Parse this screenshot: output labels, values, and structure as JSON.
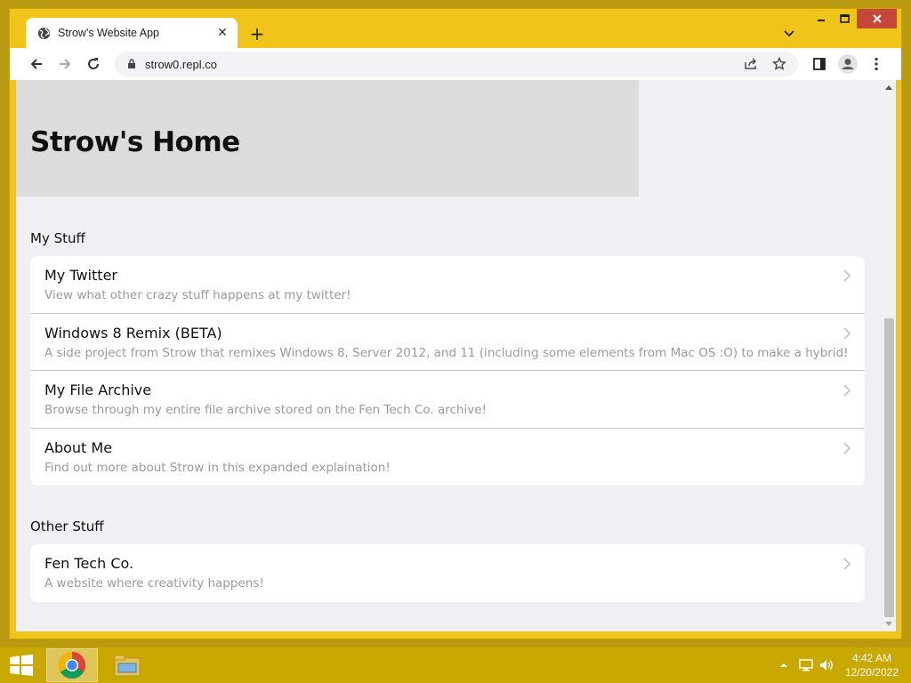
{
  "browser": {
    "tab_title": "Strow's Website App",
    "url": "strow0.repl.co"
  },
  "page": {
    "heading": "Strow's Home",
    "sections": [
      {
        "title": "My Stuff",
        "items": [
          {
            "title": "My Twitter",
            "subtitle": "View what other crazy stuff happens at my twitter!"
          },
          {
            "title": "Windows 8 Remix (BETA)",
            "subtitle": "A side project from Strow that remixes Windows 8, Server 2012, and 11 (including some elements from Mac OS :O) to make a hybrid!"
          },
          {
            "title": "My File Archive",
            "subtitle": "Browse through my entire file archive stored on the Fen Tech Co. archive!"
          },
          {
            "title": "About Me",
            "subtitle": "Find out more about Strow in this expanded explaination!"
          }
        ]
      },
      {
        "title": "Other Stuff",
        "items": [
          {
            "title": "Fen Tech Co.",
            "subtitle": "A website where creativity happens!"
          }
        ]
      }
    ]
  },
  "taskbar": {
    "time": "4:42 AM",
    "date": "12/20/2022"
  },
  "colors": {
    "window_frame": "#f0c419",
    "taskbar": "#c9a800",
    "page_bg": "#efeff4",
    "hero_bg": "#dcdcdc",
    "close_button": "#c7463b"
  }
}
